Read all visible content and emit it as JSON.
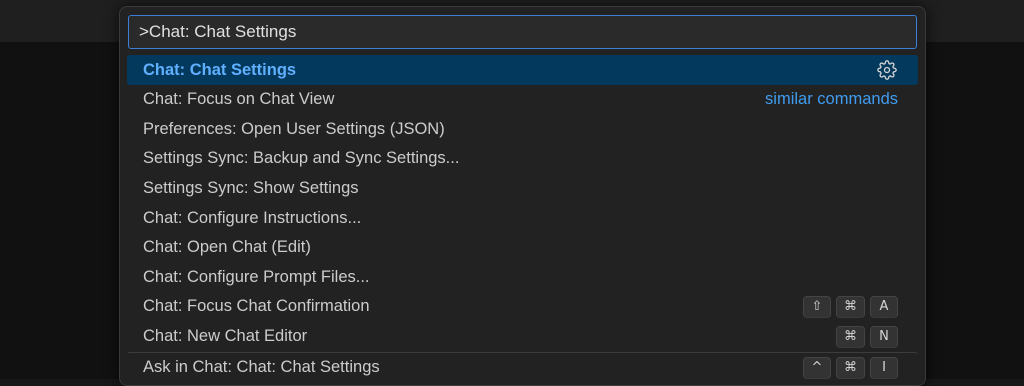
{
  "command_palette": {
    "input_value": ">Chat: Chat Settings",
    "items": [
      {
        "label": "Chat: Chat Settings",
        "selected": true,
        "icon": "gear-icon"
      },
      {
        "label": "Chat: Focus on Chat View",
        "extra": "similar commands"
      },
      {
        "label": "Preferences: Open User Settings (JSON)"
      },
      {
        "label": "Settings Sync: Backup and Sync Settings..."
      },
      {
        "label": "Settings Sync: Show Settings"
      },
      {
        "label": "Chat: Configure Instructions..."
      },
      {
        "label": "Chat: Open Chat (Edit)"
      },
      {
        "label": "Chat: Configure Prompt Files..."
      },
      {
        "label": "Chat: Focus Chat Confirmation",
        "keys": [
          "⇧",
          "⌘",
          "A"
        ]
      },
      {
        "label": "Chat: New Chat Editor",
        "keys": [
          "⌘",
          "N"
        ]
      },
      {
        "label": "Ask in Chat: Chat: Chat Settings",
        "keys": [
          "^",
          "⌘",
          "I"
        ]
      }
    ]
  },
  "colors": {
    "selected_bg": "#04395e",
    "selected_text": "#5fb0ff",
    "accent_link": "#3f9cf0",
    "focus_border": "#3b7fd6"
  }
}
